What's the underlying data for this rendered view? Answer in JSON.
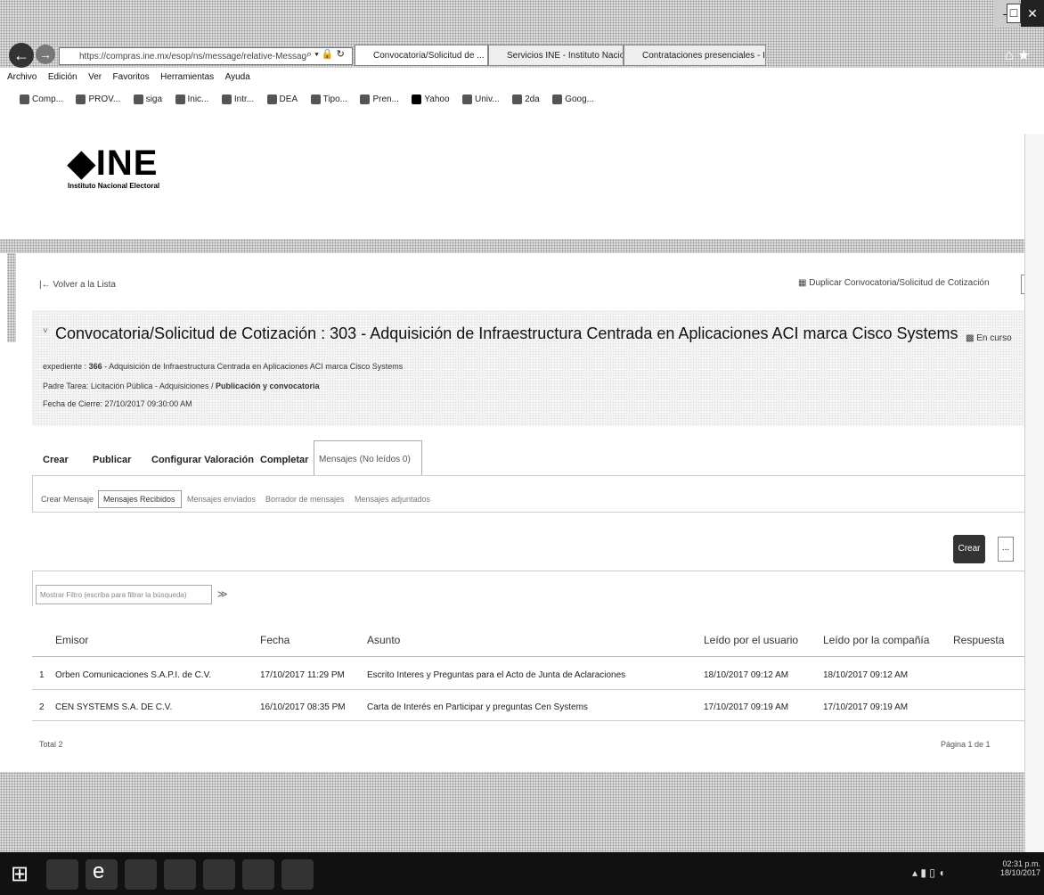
{
  "browser": {
    "address": "https://compras.ine.mx/esop/ns/message/relative-Messag",
    "tabs": [
      {
        "label": "Convocatoria/Solicitud de ...",
        "active": true
      },
      {
        "label": "Servicios INE - Instituto Nacion...",
        "active": false
      },
      {
        "label": "Contrataciones presenciales - I...",
        "active": false
      }
    ],
    "menu": [
      "Archivo",
      "Edición",
      "Ver",
      "Favoritos",
      "Herramientas",
      "Ayuda"
    ],
    "favorites": [
      "Comp...",
      "PROV...",
      "siga",
      "Inic...",
      "Intr...",
      "DEA",
      "Tipo...",
      "Pren...",
      "Yahoo",
      "Univ...",
      "2da",
      "Goog..."
    ]
  },
  "logo": {
    "name": "INE",
    "subtitle": "Instituto Nacional Electoral"
  },
  "actions": {
    "back": "Volver a la Lista",
    "duplicate": "Duplicar Convocatoria/Solicitud de Cotización",
    "more": "..."
  },
  "header": {
    "title": "Convocatoria/Solicitud de Cotización : 303 - Adquisición de Infraestructura Centrada en Aplicaciones ACI marca Cisco Systems",
    "status": "En curso",
    "expediente_label": "expediente :",
    "expediente_num": "366",
    "expediente_text": " - Adquisición de Infraestructura Centrada en Aplicaciones ACI marca Cisco Systems",
    "tarea_label": "Padre Tarea: Licitación Pública - Adquisiciones / ",
    "tarea_bold": "Publicación y convocatoria",
    "fecha_cierre": "Fecha de Cierre: 27/10/2017 09:30:00 AM"
  },
  "main_tabs": [
    "Crear",
    "Publicar",
    "Configurar Valoración",
    "Completar",
    "Mensajes (No leídos 0)"
  ],
  "sub_tabs": [
    "Crear Mensaje",
    "Mensajes Recibidos",
    "Mensajes enviados",
    "Borrador de mensajes",
    "Mensajes adjuntados"
  ],
  "create_button": "Crear",
  "filter": {
    "placeholder": "Mostrar Filtro (escriba para filtrar la búsqueda)"
  },
  "table": {
    "headers": [
      "Emisor",
      "Fecha",
      "Asunto",
      "Leído por el usuario",
      "Leído por la compañía",
      "Respuesta"
    ],
    "rows": [
      {
        "n": "1",
        "emisor": "Orben Comunicaciones S.A.P.I. de C.V.",
        "fecha": "17/10/2017 11:29 PM",
        "asunto": "Escrito Interes y Preguntas para el Acto de Junta de Aclaraciones",
        "leido_usuario": "18/10/2017 09:12 AM",
        "leido_compania": "18/10/2017 09:12 AM",
        "respuesta": ""
      },
      {
        "n": "2",
        "emisor": "CEN SYSTEMS S.A. DE C.V.",
        "fecha": "16/10/2017 08:35 PM",
        "asunto": "Carta de Interés en Participar y preguntas Cen Systems",
        "leido_usuario": "17/10/2017 09:19 AM",
        "leido_compania": "17/10/2017 09:19 AM",
        "respuesta": ""
      }
    ],
    "total": "Total 2",
    "pagination": "Página 1 de 1"
  },
  "taskbar": {
    "time": "02:31 p.m.",
    "date": "18/10/2017"
  }
}
